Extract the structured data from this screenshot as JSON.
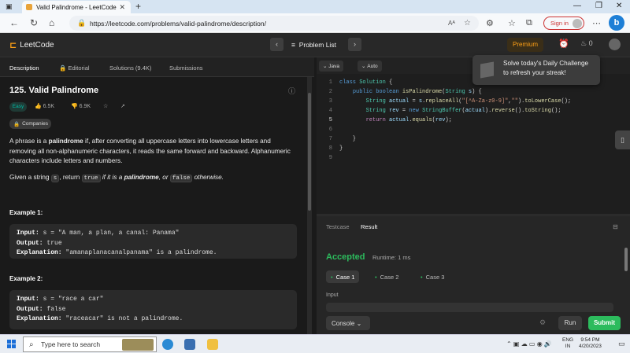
{
  "browser": {
    "tab_title": "Valid Palindrome - LeetCode",
    "url": "https://leetcode.com/problems/valid-palindrome/description/",
    "reader_mode": "Aᴬ",
    "signin_label": "Sign in"
  },
  "nav": {
    "logo": "LeetCode",
    "problem_list": "Problem List",
    "premium": "Premium",
    "streak": "0"
  },
  "left_tabs": [
    {
      "label": "Description"
    },
    {
      "label": "Editorial"
    },
    {
      "label": "Solutions (9.4K)"
    },
    {
      "label": "Submissions"
    }
  ],
  "problem": {
    "title": "125. Valid Palindrome",
    "difficulty": "Easy",
    "likes": "6.5K",
    "dislikes": "6.9K",
    "companies": "Companies",
    "desc_1a": "A phrase is a ",
    "desc_1b": "palindrome",
    "desc_1c": " if, after converting all uppercase letters into lowercase letters and removing all non-alphanumeric characters, it reads the same forward and backward. Alphanumeric characters include letters and numbers.",
    "desc_2a": "Given a string ",
    "desc_2b": "s",
    "desc_2c": ", return ",
    "desc_2d": "true",
    "desc_2e": " if it is a ",
    "desc_2f": "palindrome",
    "desc_2g": ", or ",
    "desc_2h": "false",
    "desc_2i": " otherwise.",
    "examples": [
      {
        "heading": "Example 1:",
        "input": "s = \"A man, a plan, a canal: Panama\"",
        "output": "true",
        "explanation": "\"amanaplanacanalpanama\" is a palindrome."
      },
      {
        "heading": "Example 2:",
        "input": "s = \"race a car\"",
        "output": "false",
        "explanation": "\"raceacar\" is not a palindrome."
      }
    ],
    "input_lbl": "Input:",
    "output_lbl": "Output:",
    "explanation_lbl": "Explanation:"
  },
  "editor": {
    "language": "Java",
    "mode": "Auto",
    "line_numbers": [
      "1",
      "2",
      "3",
      "4",
      "5",
      "6",
      "7",
      "8",
      "9"
    ]
  },
  "results": {
    "tab_testcase": "Testcase",
    "tab_result": "Result",
    "status": "Accepted",
    "runtime": "Runtime: 1 ms",
    "cases": [
      "Case 1",
      "Case 2",
      "Case 3"
    ],
    "input_label": "Input",
    "console": "Console",
    "run": "Run",
    "submit": "Submit"
  },
  "popup": {
    "line1": "Solve today's Daily Challenge",
    "line2": "to refresh your streak!"
  },
  "taskbar": {
    "search_placeholder": "Type here to search",
    "lang_top": "ENG",
    "lang_bottom": "IN",
    "time": "9:54 PM",
    "date": "4/20/2023"
  },
  "colors": {
    "accent": "#ffa116",
    "accepted": "#2cbb5d",
    "easy": "#00b8a3"
  }
}
